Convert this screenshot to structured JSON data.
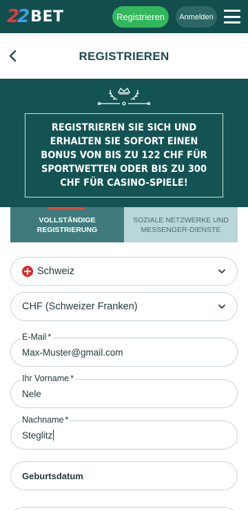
{
  "header": {
    "logo_digits": "22",
    "logo_text": "BET",
    "register_label": "Registrieren",
    "login_label": "Anmelden",
    "colors": {
      "bar": "#134e4e",
      "register": "#32b85a",
      "login": "#2c6666"
    }
  },
  "titlebar": {
    "title": "REGISTRIEREN",
    "back_icon": "chevron-left-icon"
  },
  "promo": {
    "ornament_icon": "crown-laurel-ornament-icon",
    "text": "REGISTRIEREN SIE SICH UND ERHALTEN SIE SOFORT EINEN BONUS VON BIS ZU 122 CHF FÜR SPORTWETTEN ODER BIS ZU 300 CHF FÜR CASINO-SPIELE!"
  },
  "tabs": [
    {
      "line1": "VOLLSTÄNDIGE",
      "line2": "REGISTRIERUNG",
      "active": true
    },
    {
      "line1": "SOZIALE NETZWERKE UND",
      "line2": "MESSENGER-DIENSTE",
      "active": false
    }
  ],
  "form": {
    "country": {
      "value": "Schweiz",
      "flag_icon": "swiss-flag-icon"
    },
    "currency": {
      "value": "CHF (Schweizer Franken)"
    },
    "email": {
      "label": "E-Mail",
      "required_mark": "*",
      "value": "Max-Muster@gmail.com"
    },
    "first_name": {
      "label": "Ihr Vorname",
      "required_mark": "*",
      "value": "Nele"
    },
    "last_name": {
      "label": "Nachname",
      "required_mark": "*",
      "value": "Steglitz"
    },
    "birthdate": {
      "placeholder": "Geburtsdatum"
    }
  }
}
